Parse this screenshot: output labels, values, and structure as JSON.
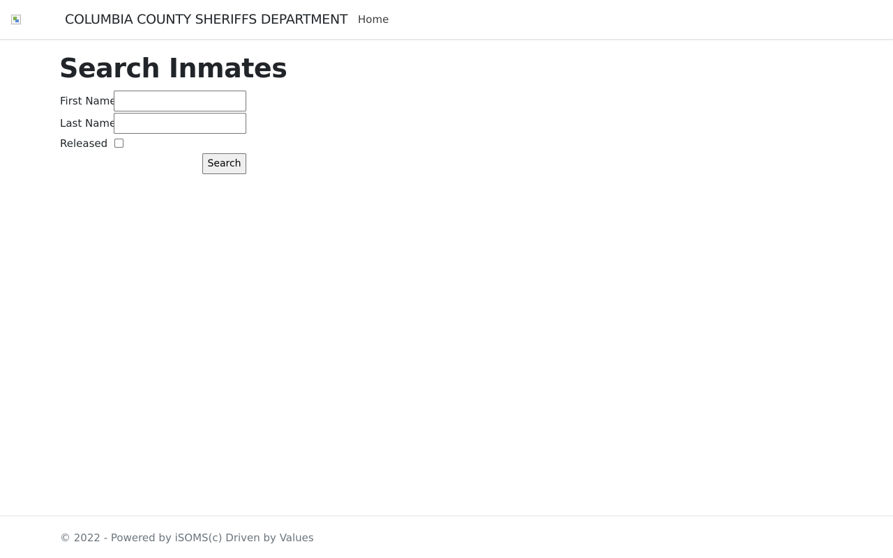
{
  "navbar": {
    "logo_icon": "broken-image-icon",
    "brand": "COLUMBIA COUNTY SHERIFFS DEPARTMENT",
    "links": [
      {
        "label": "Home"
      }
    ]
  },
  "main": {
    "title": "Search Inmates",
    "form": {
      "first_name_label": "First Name",
      "first_name_value": "",
      "last_name_label": "Last Name",
      "last_name_value": "",
      "released_label": "Released",
      "released_checked": false,
      "search_button_label": "Search"
    }
  },
  "footer": {
    "text": "© 2022 - Powered by iSOMS(c) Driven by Values"
  },
  "colors": {
    "text": "#212529",
    "muted": "#6c757d",
    "border": "#dee2e6",
    "button_bg": "#efefef"
  }
}
